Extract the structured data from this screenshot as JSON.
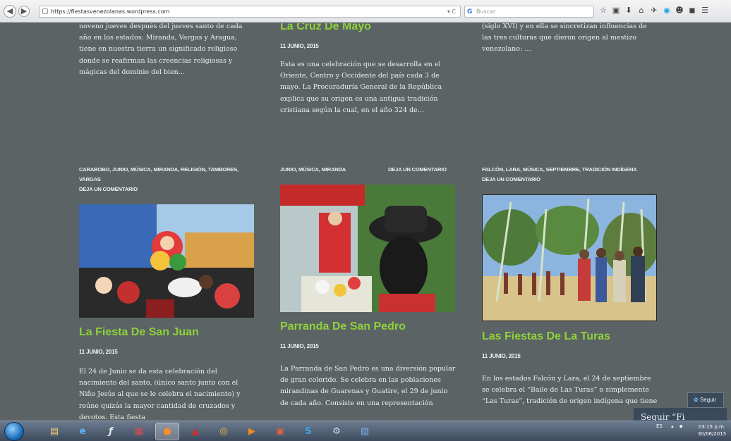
{
  "browser": {
    "url": "https://fiestasvenezolanas.wordpress.com",
    "search_placeholder": "Buscar",
    "tools": [
      "☆",
      "▣",
      "⬇",
      "⌂",
      "✈",
      "◉",
      "☻",
      "◼",
      "☰"
    ]
  },
  "top_posts": [
    {
      "excerpt": "noveno jueves después del jueves santo de cada año en los estados: Miranda, Vargas y Aragua, tiene en nuestra tierra un significado religioso donde se reafirman las creencias religiosas y mágicas del dominio del bien…"
    },
    {
      "title": "La Cruz De Mayo",
      "date": "11 JUNIO, 2015",
      "excerpt": "Esta es una celebración que se desarrolla en el Oriente, Centro y Occidente del país cada 3 de mayo. La Procuraduría General de la República explica que su origen es una antigua tradición cristiana según la cual, en el año 324 de…"
    },
    {
      "excerpt": "(siglo XVI) y en ella se sincretizan influencias de las tres culturas que dieron origen al mestizo venezolano: …"
    }
  ],
  "posts": [
    {
      "categories": "CARABOBO, JUNIO, MÚSICA, MIRANDA, RELIGIÓN, TAMBORES, VARGAS",
      "comment_link": "DEJA UN COMENTARIO",
      "title": "La Fiesta De San Juan",
      "date": "11 JUNIO, 2015",
      "excerpt": "El 24 de Junio se da esta celebración del nacimiento del santo, (único santo junto con el Niño Jesús al que se le celebra el nacimiento) y reúne quizás la mayor cantidad de cruzados y devotos. Esta fiesta"
    },
    {
      "categories": "JUNIO, MÚSICA, MIRANDA",
      "comment_link": "DEJA UN COMENTARIO",
      "title": "Parranda De San Pedro",
      "date": "11 JUNIO, 2015",
      "excerpt": "La Parranda de San Pedro es una diversión popular de gran colorido. Se celebra en las poblaciones mirandinas de Guarenas y Guatire, el 29 de junio de cada año. Consiste en una representación"
    },
    {
      "categories": "FALCÓN, LARA, MÚSICA, SEPTIEMBRE, TRADICIÓN INDÍGENA",
      "comment_link": "DEJA UN COMENTARIO",
      "title": "Las Fiestas De La Turas",
      "date": "11 JUNIO, 2015",
      "excerpt": "En los estados Falcón y Lara, el 24 de septiembre se celebra el “Baile de Las Turas” o simplemente “Las Turas”, tradición de origen indígena que tiene"
    }
  ],
  "follow": {
    "button_label": "Seguir",
    "panel_text": "Seguir “Fi"
  },
  "taskbar": {
    "language": "ES",
    "time": "03:15 p.m.",
    "date": "30/06/2015"
  }
}
